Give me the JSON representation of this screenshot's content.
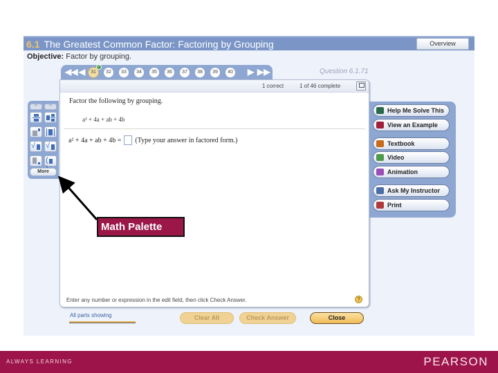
{
  "header": {
    "section_number": "6.1",
    "title": "The Greatest Common Factor: Factoring by Grouping",
    "overview_button": "Overview"
  },
  "objective": {
    "label": "Objective:",
    "text": "Factor by grouping."
  },
  "navigation": {
    "first_icon": "double-left-arrow",
    "prev_icon": "left-arrow",
    "next_icon": "right-arrow",
    "last_icon": "double-right-arrow",
    "questions": [
      {
        "label": "31",
        "current": true,
        "completed": true
      },
      {
        "label": "32",
        "current": false,
        "completed": false
      },
      {
        "label": "33",
        "current": false,
        "completed": false
      },
      {
        "label": "34",
        "current": false,
        "completed": false
      },
      {
        "label": "35",
        "current": false,
        "completed": false
      },
      {
        "label": "36",
        "current": false,
        "completed": false
      },
      {
        "label": "37",
        "current": false,
        "completed": false
      },
      {
        "label": "38",
        "current": false,
        "completed": false
      },
      {
        "label": "39",
        "current": false,
        "completed": false
      },
      {
        "label": "40",
        "current": false,
        "completed": false
      }
    ],
    "question_id": "Question 6.1.71"
  },
  "panel": {
    "status_correct": "1 correct",
    "status_complete": "1 of 46 complete",
    "prompt": "Factor the following by grouping.",
    "given_expression": "a² + 4a + ab + 4b",
    "answer_lhs": "a² + 4a + ab + 4b =",
    "answer_hint": "(Type your answer in factored form.)",
    "answer_value": "",
    "instructions": "Enter any number or expression in the edit field, then click Check Answer."
  },
  "math_palette": {
    "undo_label": "↶",
    "redo_label": "↷",
    "more_label": "More",
    "buttons": [
      "fraction",
      "mixed-number",
      "exponent",
      "absolute-value",
      "square-root",
      "nth-root",
      "subscript",
      "parentheses"
    ]
  },
  "tools": [
    {
      "label": "Help Me Solve This",
      "icon": "key-icon",
      "color": "#2a6a4a"
    },
    {
      "label": "View an Example",
      "icon": "example-icon",
      "color": "#a0203a"
    },
    {
      "label": "Textbook",
      "icon": "textbook-icon",
      "color": "#c76a1a"
    },
    {
      "label": "Video",
      "icon": "video-icon",
      "color": "#4f9a4a"
    },
    {
      "label": "Animation",
      "icon": "animation-icon",
      "color": "#9a4fb8"
    },
    {
      "label": "Ask My Instructor",
      "icon": "instructor-icon",
      "color": "#4a6fa8"
    },
    {
      "label": "Print",
      "icon": "print-icon",
      "color": "#b03a3a"
    }
  ],
  "bottom": {
    "parts_label": "All parts showing",
    "clear_all": "Clear All",
    "check_answer": "Check Answer",
    "close": "Close"
  },
  "annotation": {
    "label": "Math Palette"
  },
  "footer": {
    "tagline": "ALWAYS LEARNING",
    "brand": "PEARSON"
  },
  "colors": {
    "brand": "#9c1449",
    "header_blue": "#7a95c6",
    "panel_blue": "#8ea7d2",
    "button_gold": "#f1bb57"
  }
}
